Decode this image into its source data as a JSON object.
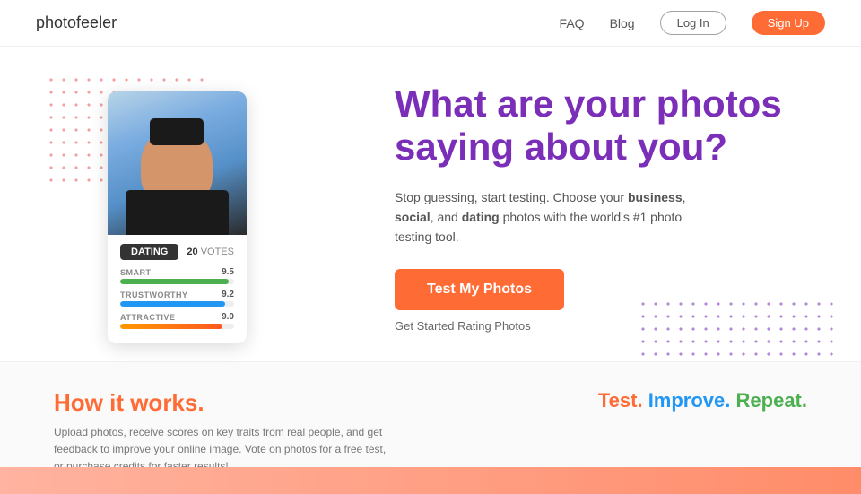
{
  "header": {
    "logo": "photofeeler",
    "nav": {
      "faq": "FAQ",
      "blog": "Blog",
      "login": "Log In",
      "signup": "Sign Up"
    }
  },
  "hero": {
    "photo_card": {
      "tab_label": "DATING",
      "votes_count": "20",
      "votes_label": "VOTES",
      "bars": [
        {
          "label": "SMART",
          "score": "9.5",
          "width": "95",
          "type": "green"
        },
        {
          "label": "TRUSTWORTHY",
          "score": "9.2",
          "width": "92",
          "type": "blue"
        },
        {
          "label": "ATTRACTIVE",
          "score": "9.0",
          "width": "90",
          "type": "orange"
        }
      ]
    },
    "headline": "What are your photos saying about you?",
    "subtext_prefix": "Stop guessing, start testing. Choose your ",
    "subtext_bold1": "business",
    "subtext_mid": ", ",
    "subtext_bold2": "social",
    "subtext_suffix": ", and ",
    "subtext_bold3": "dating",
    "subtext_end": " photos with the world's #1 photo testing tool.",
    "cta_button": "Test My Photos",
    "get_started": "Get Started Rating Photos"
  },
  "how_section": {
    "title": "How it works.",
    "description": "Upload photos, receive scores on key traits from real people, and get feedback to improve your online image. Vote on photos for a free test, or purchase credits for faster results!",
    "test_improve": {
      "test": "Test.",
      "improve": " Improve.",
      "repeat": " Repeat."
    }
  }
}
